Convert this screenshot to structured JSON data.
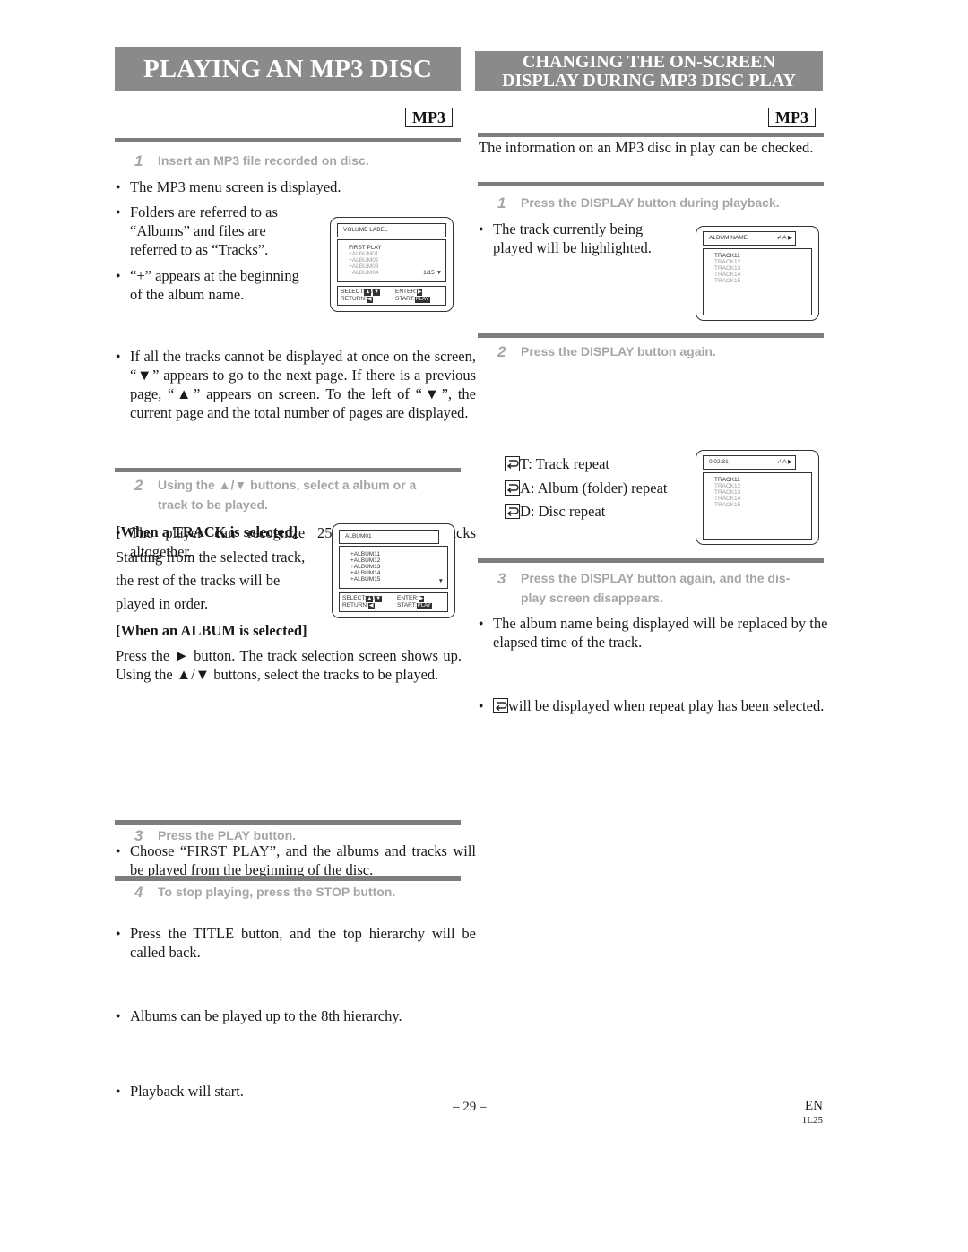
{
  "left": {
    "title": "PLAYING AN MP3 DISC",
    "badge": "MP3",
    "steps": [
      {
        "num": "1",
        "text": "Insert an MP3 file recorded on disc."
      },
      {
        "num": "2",
        "text": "Using the ▲/▼ buttons, select a album or a",
        "text2": "track to be played."
      },
      {
        "num": "3",
        "text": "Press the PLAY button."
      },
      {
        "num": "4",
        "text": "To stop playing, press the STOP button."
      }
    ],
    "bullets_step1": [
      "The MP3 menu screen is displayed.",
      "Folders are referred to as",
      "“Albums” and files are",
      "referred to as “Tracks”.",
      "“+” appears at the beginning",
      "of the album name."
    ],
    "bullet_pages": "If all the tracks cannot be displayed at once on the screen, “▼” appears to go to the next page. If there is a previous page, “▲” appears on screen. To the left of “▼”, the current page and the total number of pages are displayed.",
    "bullet_255": "The player can recognize 255 albums and tracks altogether.",
    "track_heading": "[When a TRACK is selected]",
    "track_lines": [
      "Starting from the selected track,",
      "the rest of the tracks will be",
      "played in order."
    ],
    "album_heading": "[When an ALBUM is selected]",
    "album_para": "Press the ► button. The track selection screen shows up. Using the ▲/▼ buttons, select the tracks to be played.",
    "album_bullets": [
      "Choose “FIRST PLAY”, and the albums and tracks will be played from the beginning of the disc.",
      "Press the TITLE button, and the top hierarchy will be called back.",
      "Albums can be played up to the 8th hierarchy."
    ],
    "play_bullet": "Playback will start.",
    "osd_menu": {
      "header": "VOLUME LABEL",
      "items": [
        "FIRST PLAY",
        "+ALBUM01",
        "+ALBUM02",
        "+ALBUM03",
        "+ALBUM04"
      ],
      "page": "1/15 ▼",
      "select": "SELECT:",
      "enter": "ENTER:",
      "return": "RETURN:",
      "start": "START:",
      "play_key": "PLAY"
    },
    "osd_album": {
      "header": "ALBUM01",
      "items": [
        "+ALBUM11",
        "+ALBUM12",
        "+ALBUM13",
        "+ALBUM14",
        "+ALBUM15"
      ],
      "page": "▼",
      "select": "SELECT:",
      "enter": "ENTER:",
      "return": "RETURN:",
      "start": "START:",
      "play_key": "PLAY"
    }
  },
  "right": {
    "title_line1": "CHANGING THE ON-SCREEN",
    "title_line2": "DISPLAY DURING MP3 DISC PLAY",
    "badge": "MP3",
    "intro": "The information on an MP3 disc in play can be checked.",
    "steps": [
      {
        "num": "1",
        "text": "Press the DISPLAY button during playback."
      },
      {
        "num": "2",
        "text": "Press the DISPLAY button again."
      },
      {
        "num": "3",
        "text": "Press the DISPLAY button again, and the dis-",
        "text2": "play screen disappears."
      }
    ],
    "bullet_highlight": [
      "The track currently being",
      "played will be highlighted."
    ],
    "bullet_replace": "The album name being displayed will be replaced by the elapsed time of the track.",
    "bullet_repeat": "will be displayed when repeat play has been selected.",
    "repeat_modes": [
      "T: Track repeat",
      "A: Album (folder) repeat",
      "D: Disc repeat"
    ],
    "osd_album_name": {
      "header": "ALBUM NAME",
      "status": "↲ A ▶",
      "tracks": [
        "TRACK11",
        "TRACK12",
        "TRACK13",
        "TRACK14",
        "TRACK15"
      ]
    },
    "osd_elapsed": {
      "header": "0:02:31",
      "status": "↲ A ▶",
      "tracks": [
        "TRACK11",
        "TRACK12",
        "TRACK13",
        "TRACK14",
        "TRACK15"
      ]
    }
  },
  "footer": {
    "page_number": "– 29 –",
    "lang": "EN",
    "code": "1L25"
  }
}
